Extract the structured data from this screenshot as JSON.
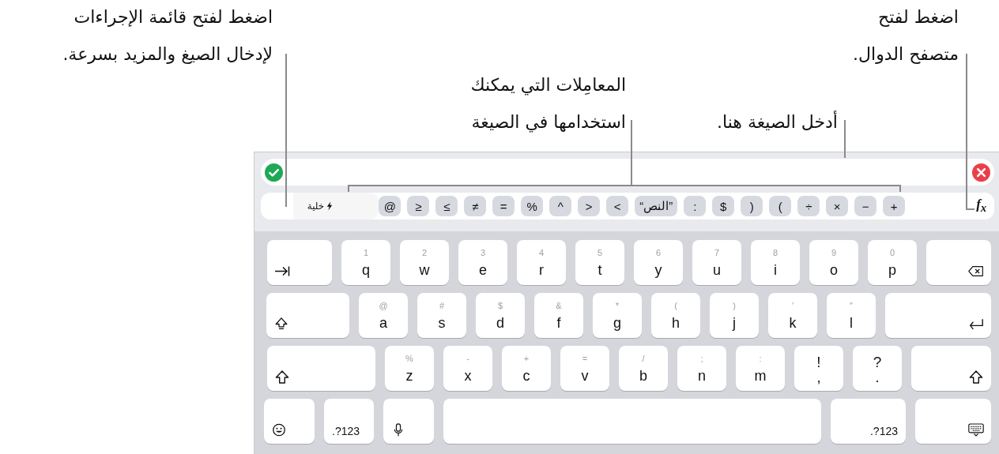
{
  "callouts": [
    {
      "lines": [
        "اضغط لفتح",
        "متصفح الدوال."
      ]
    },
    {
      "lines": [
        "اضغط لفتح قائمة الإجراءات",
        "لإدخال الصيغ والمزيد بسرعة."
      ]
    },
    {
      "lines": [
        "أدخل الصيغة هنا."
      ]
    },
    {
      "lines": [
        "المعامِلات التي يمكنك",
        "استخدامها في الصيغة"
      ]
    }
  ],
  "toolbar": {
    "cell_button": "خلية",
    "operators": [
      "+",
      "−",
      "×",
      "÷",
      ")",
      "(",
      "$",
      ":",
      "”النص“",
      ">",
      "<",
      "^",
      "%",
      "=",
      "≠",
      "≥",
      "≤",
      "@"
    ],
    "function_button": "f$_{x}$"
  },
  "keyboard": {
    "rows": [
      {
        "keys": [
          {
            "kind": "delete"
          },
          {
            "kind": "letter",
            "label": "p",
            "hint": "0"
          },
          {
            "kind": "letter",
            "label": "o",
            "hint": "9"
          },
          {
            "kind": "letter",
            "label": "i",
            "hint": "8"
          },
          {
            "kind": "letter",
            "label": "u",
            "hint": "7"
          },
          {
            "kind": "letter",
            "label": "y",
            "hint": "6"
          },
          {
            "kind": "letter",
            "label": "t",
            "hint": "5"
          },
          {
            "kind": "letter",
            "label": "r",
            "hint": "4"
          },
          {
            "kind": "letter",
            "label": "e",
            "hint": "3"
          },
          {
            "kind": "letter",
            "label": "w",
            "hint": "2"
          },
          {
            "kind": "letter",
            "label": "q",
            "hint": "1"
          },
          {
            "kind": "tab"
          }
        ]
      },
      {
        "keys": [
          {
            "kind": "return"
          },
          {
            "kind": "letter",
            "label": "l",
            "hint": "″"
          },
          {
            "kind": "letter",
            "label": "k",
            "hint": "′"
          },
          {
            "kind": "letter",
            "label": "j",
            "hint": ")"
          },
          {
            "kind": "letter",
            "label": "h",
            "hint": "("
          },
          {
            "kind": "letter",
            "label": "g",
            "hint": "*"
          },
          {
            "kind": "letter",
            "label": "f",
            "hint": "&"
          },
          {
            "kind": "letter",
            "label": "d",
            "hint": "$"
          },
          {
            "kind": "letter",
            "label": "s",
            "hint": "#"
          },
          {
            "kind": "letter",
            "label": "a",
            "hint": "@"
          },
          {
            "kind": "capslock"
          }
        ]
      },
      {
        "keys": [
          {
            "kind": "shift"
          },
          {
            "kind": "punct",
            "label": ".",
            "hint": "?"
          },
          {
            "kind": "punct",
            "label": ",",
            "hint": "!"
          },
          {
            "kind": "letter",
            "label": "m",
            "hint": ":"
          },
          {
            "kind": "letter",
            "label": "n",
            "hint": ";"
          },
          {
            "kind": "letter",
            "label": "b",
            "hint": "/"
          },
          {
            "kind": "letter",
            "label": "v",
            "hint": "="
          },
          {
            "kind": "letter",
            "label": "c",
            "hint": "+"
          },
          {
            "kind": "letter",
            "label": "x",
            "hint": "-"
          },
          {
            "kind": "letter",
            "label": "z",
            "hint": "%"
          },
          {
            "kind": "shift"
          }
        ]
      },
      {
        "keys": [
          {
            "kind": "hide"
          },
          {
            "kind": "numbers",
            "label": ".?123"
          },
          {
            "kind": "space"
          },
          {
            "kind": "mic"
          },
          {
            "kind": "numbers",
            "label": ".?123"
          },
          {
            "kind": "emoji"
          }
        ]
      }
    ]
  }
}
